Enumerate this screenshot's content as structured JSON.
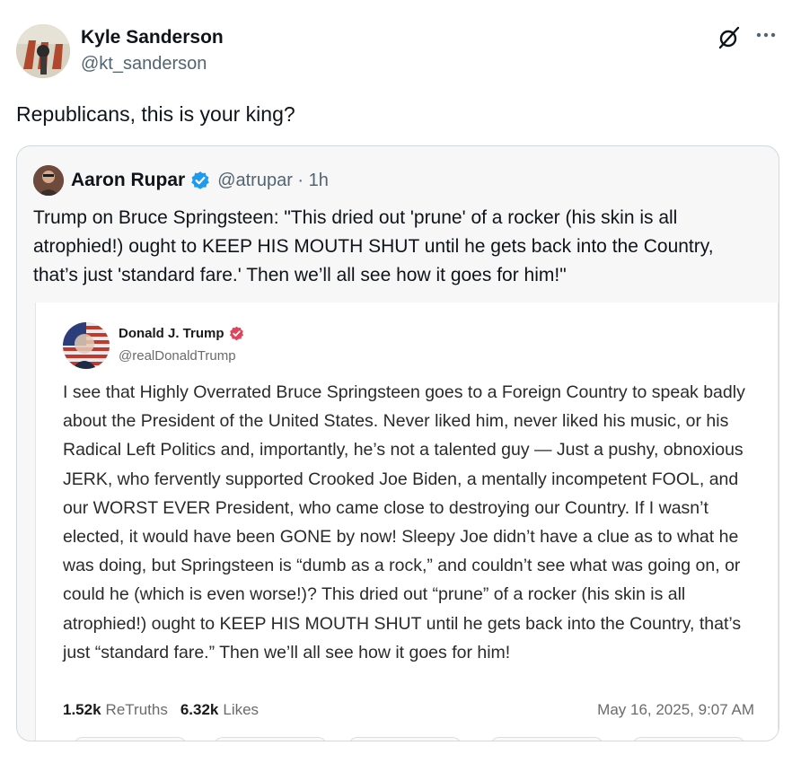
{
  "author": {
    "name": "Kyle Sanderson",
    "handle": "@kt_sanderson"
  },
  "tweet": {
    "text": "Republicans, this is your king?"
  },
  "quoted": {
    "name": "Aaron Rupar",
    "handle_time": "@atrupar · 1h",
    "text": "Trump on Bruce Springsteen: \"This dried out 'prune' of a rocker (his skin is all atrophied!) ought to KEEP HIS MOUTH SHUT until he gets back into the Country, that’s just 'standard fare.' Then we’ll all see how it goes for him!\""
  },
  "embed": {
    "name": "Donald J. Trump",
    "handle": "@realDonaldTrump",
    "text": "I see that Highly Overrated Bruce Springsteen goes to a Foreign Country to speak badly about the President of the United States. Never liked him, never liked his music, or his Radical Left Politics and, importantly, he’s not a talented guy — Just a pushy, obnoxious JERK, who fervently supported Crooked Joe Biden, a mentally incompetent FOOL, and our WORST EVER President, who came close to destroying our Country. If I wasn’t elected, it would have been GONE by now! Sleepy Joe didn’t have a clue as to what he was doing, but Springsteen is “dumb as a rock,” and couldn’t see what was going on, or could he (which is even worse!)? This dried out “prune” of a rocker (his skin is all atrophied!) ought to KEEP HIS MOUTH SHUT until he gets back into the Country, that’s just “standard fare.” Then we’ll all see how it goes for him!",
    "retruths_count": "1.52k",
    "retruths_label": "ReTruths",
    "likes_count": "6.32k",
    "likes_label": "Likes",
    "date": "May 16, 2025, 9:07 AM"
  },
  "icons": {
    "grok": "grok-icon",
    "more": "more-icon",
    "verified": "verified-icon"
  },
  "colors": {
    "verified_blue": "#1d9bf0",
    "truth_verified": "#e2435a",
    "secondary_text": "#536471"
  }
}
